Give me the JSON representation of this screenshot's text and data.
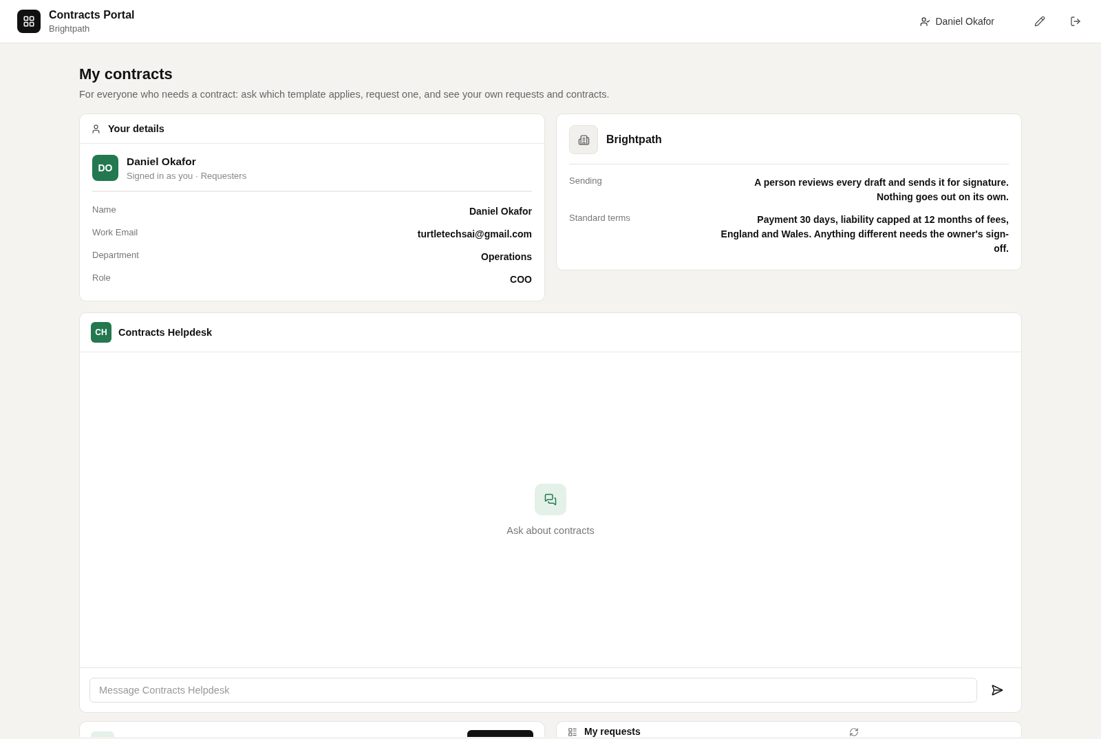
{
  "header": {
    "app_title": "Contracts Portal",
    "org": "Brightpath",
    "user": "Daniel Okafor"
  },
  "page": {
    "title": "My contracts",
    "subtitle": "For everyone who needs a contract: ask which template applies, request one, and see your own requests and contracts."
  },
  "details": {
    "title": "Your details",
    "initials": "DO",
    "name": "Daniel Okafor",
    "meta": "Signed in as you · Requesters",
    "fields": [
      {
        "label": "Name",
        "value": "Daniel Okafor"
      },
      {
        "label": "Work Email",
        "value": "turtletechsai@gmail.com"
      },
      {
        "label": "Department",
        "value": "Operations"
      },
      {
        "label": "Role",
        "value": "COO"
      }
    ]
  },
  "company": {
    "name": "Brightpath",
    "fields": [
      {
        "label": "Sending",
        "value": "A person reviews every draft and sends it for signature. Nothing goes out on its own."
      },
      {
        "label": "Standard terms",
        "value": "Payment 30 days, liability capped at 12 months of fees, England and Wales. Anything different needs the owner's sign-off."
      }
    ]
  },
  "helpdesk": {
    "initials": "CH",
    "title": "Contracts Helpdesk",
    "empty_text": "Ask about contracts",
    "placeholder": "Message Contracts Helpdesk"
  },
  "requests": {
    "title": "My requests"
  }
}
